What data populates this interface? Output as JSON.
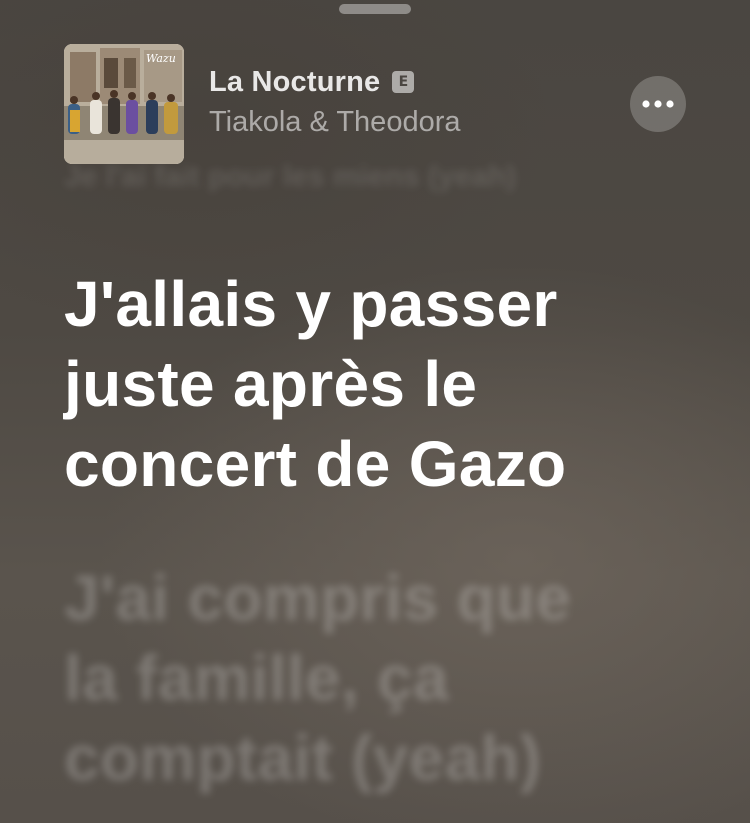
{
  "now_playing": {
    "title": "La Nocturne",
    "explicit_badge": "E",
    "artist": "Tiakola & Theodora",
    "artwork_text": "Wazu"
  },
  "lyrics": {
    "previous_line": "Je l'ai fait pour les miens (yeah)",
    "current": [
      "J'allais y passer",
      "juste après le",
      "concert de Gazo"
    ],
    "next": [
      "J'ai compris que",
      "la famille, ça",
      "comptait (yeah)"
    ]
  },
  "colors": {
    "background": "#4e4943",
    "active_lyric": "#ffffff"
  },
  "icons": {
    "more": "ellipsis-icon"
  }
}
